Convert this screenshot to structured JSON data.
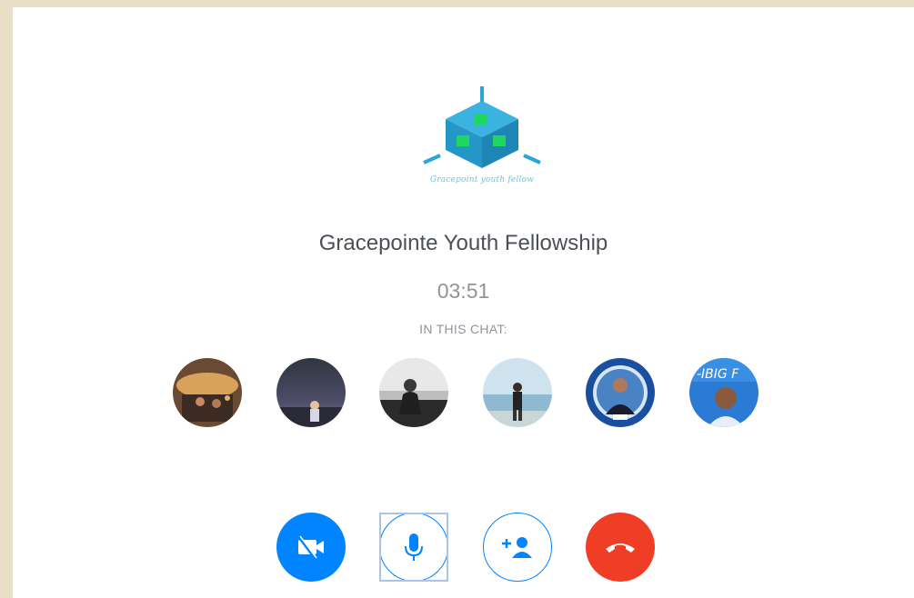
{
  "call": {
    "logo_tagline": "Gracepoint youth fellow",
    "group_name": "Gracepointe Youth Fellowship",
    "timer": "03:51",
    "participants_heading": "IN THIS CHAT:"
  },
  "participants": [
    {
      "name": "participant-1"
    },
    {
      "name": "participant-2"
    },
    {
      "name": "participant-3"
    },
    {
      "name": "participant-4"
    },
    {
      "name": "participant-5"
    },
    {
      "name": "participant-6"
    }
  ],
  "controls": [
    {
      "name": "video-off-button",
      "icon": "video-off-icon"
    },
    {
      "name": "microphone-button",
      "icon": "microphone-icon"
    },
    {
      "name": "add-person-button",
      "icon": "add-person-icon"
    },
    {
      "name": "end-call-button",
      "icon": "end-call-icon"
    }
  ],
  "colors": {
    "accent": "#0084ff",
    "end_call": "#f03d25",
    "background": "#e9dfc6"
  }
}
